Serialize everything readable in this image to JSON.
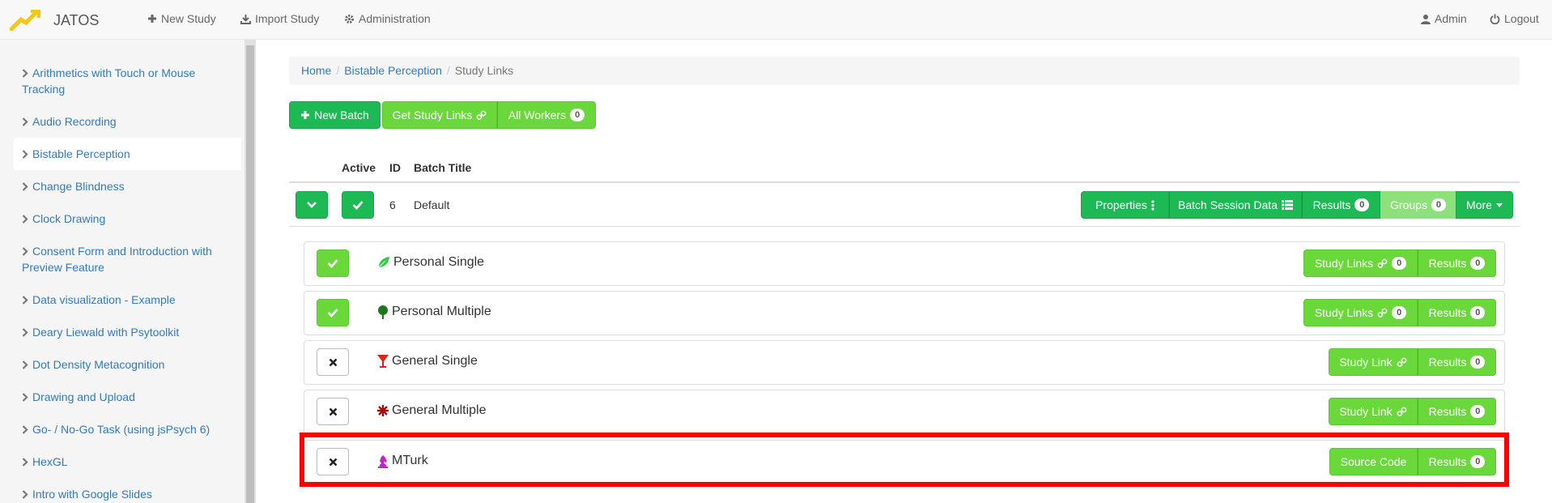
{
  "navbar": {
    "brand": "JATOS",
    "new_study": "New Study",
    "import_study": "Import Study",
    "administration": "Administration",
    "user": "Admin",
    "logout": "Logout"
  },
  "sidebar": {
    "items": [
      {
        "label": "Arithmetics with Touch or Mouse Tracking"
      },
      {
        "label": "Audio Recording"
      },
      {
        "label": "Bistable Perception"
      },
      {
        "label": "Change Blindness"
      },
      {
        "label": "Clock Drawing"
      },
      {
        "label": "Consent Form and Introduction with Preview Feature"
      },
      {
        "label": "Data visualization - Example"
      },
      {
        "label": "Deary Liewald with Psytoolkit"
      },
      {
        "label": "Dot Density Metacognition"
      },
      {
        "label": "Drawing and Upload"
      },
      {
        "label": "Go- / No-Go Task (using jsPsych 6)"
      },
      {
        "label": "HexGL"
      },
      {
        "label": "Intro with Google Slides"
      }
    ],
    "active_label": "Bistable Perception"
  },
  "breadcrumb": {
    "home": "Home",
    "study": "Bistable Perception",
    "current": "Study Links",
    "separator": "/"
  },
  "toolbar": {
    "new_batch": "New Batch",
    "get_study_links": "Get Study Links",
    "all_workers": "All Workers",
    "all_workers_count": "0"
  },
  "table": {
    "headers": {
      "active": "Active",
      "id": "ID",
      "batch_title": "Batch Title"
    },
    "batch": {
      "id": "6",
      "title": "Default",
      "properties": "Properties",
      "batch_session_data": "Batch Session Data",
      "results": "Results",
      "results_count": "0",
      "groups": "Groups",
      "groups_count": "0",
      "more": "More"
    }
  },
  "worker_types": [
    {
      "name": "Personal Single",
      "active": true,
      "icon": "leaf-icon",
      "icon_color": "#2ecc40",
      "link_label": "Study Links",
      "link_count": "0",
      "results_label": "Results",
      "results_count": "0"
    },
    {
      "name": "Personal Multiple",
      "active": true,
      "icon": "tree-icon",
      "icon_color": "#1a7a1a",
      "link_label": "Study Links",
      "link_count": "0",
      "results_label": "Results",
      "results_count": "0"
    },
    {
      "name": "General Single",
      "active": false,
      "icon": "glass-icon",
      "icon_color": "#e0201b",
      "link_label": "Study Link",
      "results_label": "Results",
      "results_count": "0"
    },
    {
      "name": "General Multiple",
      "active": false,
      "icon": "asterisk-icon",
      "icon_color": "#a50e0e",
      "link_label": "Study Link",
      "results_label": "Results",
      "results_count": "0"
    },
    {
      "name": "MTurk",
      "active": false,
      "icon": "knight-icon",
      "icon_color": "#c61ed1",
      "link_label": "Source Code",
      "results_label": "Results",
      "results_count": "0"
    }
  ],
  "colors": {
    "primary_green": "#1db954",
    "light_green": "#6ad83a",
    "link_blue": "#337ab7",
    "highlight_red": "#ff0000"
  }
}
